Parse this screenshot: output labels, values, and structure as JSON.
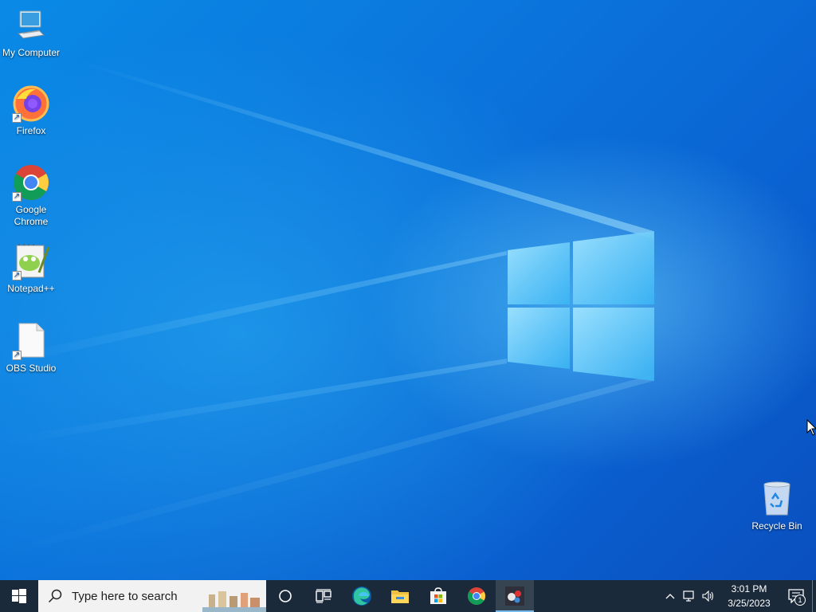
{
  "desktop": {
    "icons": [
      {
        "label": "My Computer",
        "icon": "monitor-icon"
      },
      {
        "label": "Firefox",
        "icon": "firefox-icon",
        "shortcut": true
      },
      {
        "label": "Google Chrome",
        "icon": "chrome-icon",
        "shortcut": true
      },
      {
        "label": "Notepad++",
        "icon": "notepad-plus-plus-icon",
        "shortcut": true
      },
      {
        "label": "OBS Studio",
        "icon": "blank-file-icon",
        "shortcut": true
      },
      {
        "label": "Recycle Bin",
        "icon": "recycle-bin-icon"
      }
    ]
  },
  "taskbar": {
    "search": {
      "placeholder": "Type here to search"
    },
    "pinned": [
      "start-icon",
      "cortana-icon",
      "task-view-icon",
      "edge-icon",
      "file-explorer-icon",
      "store-icon",
      "chrome-icon",
      "obs-icon"
    ],
    "clock": {
      "time": "3:01 PM",
      "date": "3/25/2023"
    },
    "notifications": {
      "count": "1"
    }
  },
  "colors": {
    "desktop": "#0a6fd6",
    "taskbar": "#1b2a3a",
    "search_box": "#f2f2f2"
  }
}
